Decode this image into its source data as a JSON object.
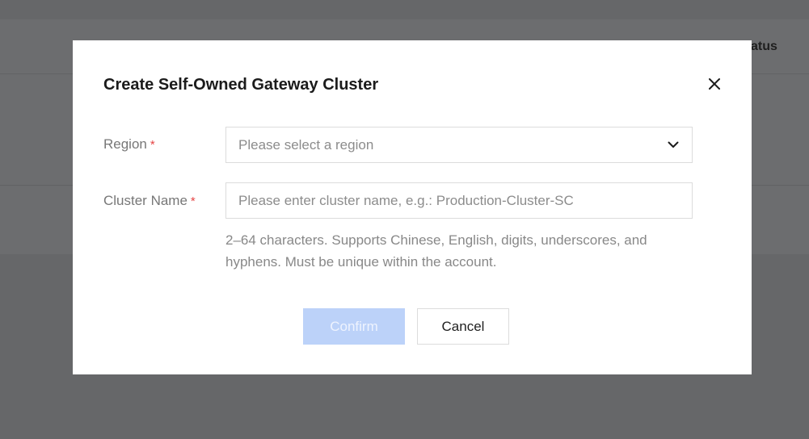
{
  "background": {
    "status_column_label": "atus"
  },
  "dialog": {
    "title": "Create Self-Owned Gateway Cluster",
    "close_icon": "close-icon",
    "region": {
      "label": "Region",
      "required_mark": "*",
      "placeholder": "Please select a region",
      "dropdown_icon": "chevron-down-icon"
    },
    "cluster_name": {
      "label": "Cluster Name",
      "required_mark": "*",
      "placeholder": "Please enter cluster name, e.g.: Production-Cluster-SC",
      "value": "",
      "hint": "2–64 characters. Supports Chinese, English, digits, underscores, and hyphens. Must be unique within the account."
    },
    "buttons": {
      "confirm_label": "Confirm",
      "cancel_label": "Cancel"
    }
  },
  "colors": {
    "overlay_bg": "#6a6b6d",
    "dialog_bg": "#ffffff",
    "required": "#e54545",
    "confirm_disabled_bg": "#bcd2f9"
  }
}
